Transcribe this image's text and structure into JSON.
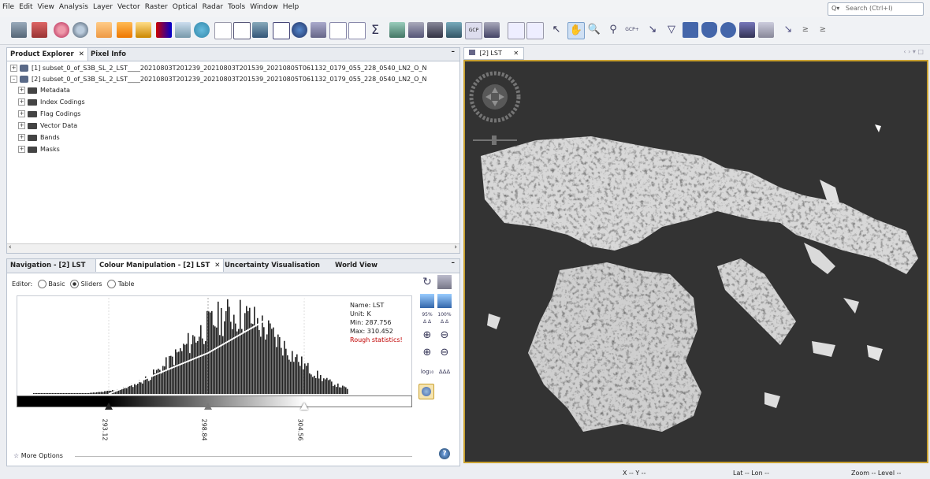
{
  "menu": [
    "File",
    "Edit",
    "View",
    "Analysis",
    "Layer",
    "Vector",
    "Raster",
    "Optical",
    "Radar",
    "Tools",
    "Window",
    "Help"
  ],
  "search": {
    "placeholder": "Search (Ctrl+I)"
  },
  "explorer": {
    "tabs": [
      "Product Explorer",
      "Pixel Info"
    ],
    "products": [
      "[1] subset_0_of_S3B_SL_2_LST____20210803T201239_20210803T201539_20210805T061132_0179_055_228_0540_LN2_O_N",
      "[2] subset_0_of_S3B_SL_2_LST____20210803T201239_20210803T201539_20210805T061132_0179_055_228_0540_LN2_O_N"
    ],
    "nodes": [
      "Metadata",
      "Index Codings",
      "Flag Codings",
      "Vector Data",
      "Bands",
      "Masks"
    ]
  },
  "lower_tabs": [
    "Navigation - [2] LST",
    "Colour Manipulation - [2] LST",
    "Uncertainty Visualisation",
    "World View"
  ],
  "editor": {
    "label": "Editor:",
    "options": [
      "Basic",
      "Sliders",
      "Table"
    ],
    "selected": "Sliders"
  },
  "stats": {
    "name": "Name: LST",
    "unit": "Unit: K",
    "min": "Min: 287.756",
    "max": "Max: 310.452",
    "rough": "Rough statistics!"
  },
  "sliders": [
    "293.12",
    "298.84",
    "304.56"
  ],
  "more_options": "More Options",
  "image_tab": "[2] LST",
  "status": {
    "x": "X -- Y --",
    "lat": "Lat -- Lon --",
    "zoom": "Zoom -- Level --"
  },
  "colors": {
    "rough": "#c00000",
    "selection": "#c8a030"
  }
}
